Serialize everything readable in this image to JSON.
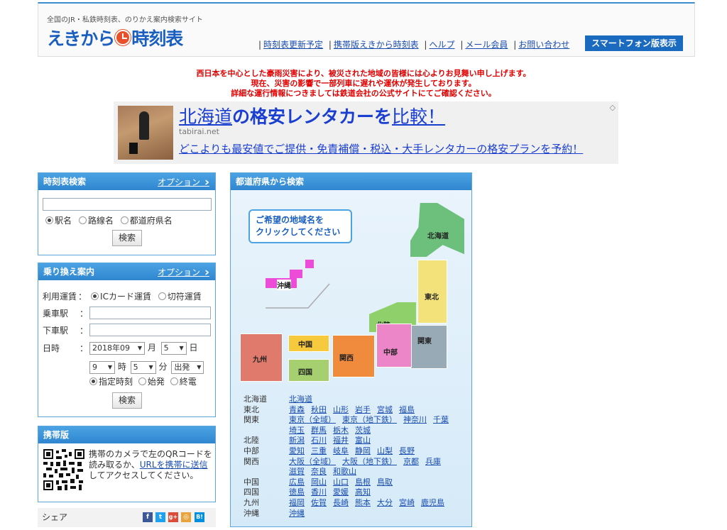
{
  "header": {
    "tagline": "全国のJR・私鉄時刻表、のりかえ案内検索サイト",
    "logo_left": "えきから",
    "logo_right": "時刻表",
    "nav": [
      "時刻表更新予定",
      "携帯版えきから時刻表",
      "ヘルプ",
      "メール会員",
      "お問い合わせ"
    ],
    "smartphone_button": "スマートフォン版表示"
  },
  "notice": [
    "西日本を中心とした豪雨災害により、被災された地域の皆様には心よりお見舞い申し上げます。",
    "現在、災害の影響で一部列車に遅れや運休が発生しております。",
    "詳細な運行情報につきましては鉄道会社の公式サイトにてご確認ください。"
  ],
  "ad": {
    "title_a": "北海道",
    "title_b": "の格安",
    "title_c": "レンタカーを",
    "title_d": "比較！",
    "domain": "tabirai.net",
    "description": "どこよりも最安値でご提供・免責補償・税込・大手レンタカーの格安プランを予約！"
  },
  "timetable": {
    "title": "時刻表検索",
    "option": "オプション",
    "input_value": "",
    "radio": [
      "駅名",
      "路線名",
      "都道府県名"
    ],
    "search": "検索"
  },
  "transfer": {
    "title": "乗り換え案内",
    "option": "オプション",
    "fare_label": "利用運賃",
    "fare_options": [
      "ICカード運賃",
      "切符運賃"
    ],
    "from_label": "乗車駅",
    "to_label": "下車駅",
    "date_label": "日時",
    "year_month": "2018年09",
    "month_unit": "月",
    "day": "5",
    "day_unit": "日",
    "hour": "9",
    "hour_unit": "時",
    "minute": "5",
    "minute_unit": "分",
    "mode": "出発",
    "time_options": [
      "指定時刻",
      "始発",
      "終電"
    ],
    "search": "検索",
    "colon": "："
  },
  "mobile": {
    "title": "携帯版",
    "text_a": "携帯のカメラで左のQRコードを読み取るか、",
    "link": "URLを携帯に送信",
    "text_b": "してアクセスしてください。"
  },
  "share": {
    "label": "シェア",
    "icons": [
      "f",
      "t",
      "g+",
      "◎",
      "B!"
    ]
  },
  "prefecture": {
    "title": "都道府県から検索",
    "callout_1": "ご希望の地域名を",
    "callout_2": "クリックしてください",
    "regions": {
      "hokkaido": "北海道",
      "tohoku": "東北",
      "hokuriku": "北陸",
      "kanto": "関東",
      "chubu": "中部",
      "kansai": "関西",
      "chugoku": "中国",
      "shikoku": "四国",
      "kyushu": "九州",
      "okinawa": "沖縄"
    },
    "list": [
      {
        "region": "北海道",
        "prefs": [
          "北海道"
        ]
      },
      {
        "region": "東北",
        "prefs": [
          "青森",
          "秋田",
          "山形",
          "岩手",
          "宮城",
          "福島"
        ]
      },
      {
        "region": "関東",
        "prefs": [
          "東京（全域）",
          "東京（地下鉄）",
          "神奈川",
          "千葉"
        ]
      },
      {
        "region": "",
        "prefs": [
          "埼玉",
          "群馬",
          "栃木",
          "茨城"
        ]
      },
      {
        "region": "北陸",
        "prefs": [
          "新潟",
          "石川",
          "福井",
          "富山"
        ]
      },
      {
        "region": "中部",
        "prefs": [
          "愛知",
          "三重",
          "岐阜",
          "静岡",
          "山梨",
          "長野"
        ]
      },
      {
        "region": "関西",
        "prefs": [
          "大阪（全域）",
          "大阪（地下鉄）",
          "京都",
          "兵庫"
        ]
      },
      {
        "region": "",
        "prefs": [
          "滋賀",
          "奈良",
          "和歌山"
        ]
      },
      {
        "region": "中国",
        "prefs": [
          "広島",
          "岡山",
          "山口",
          "島根",
          "鳥取"
        ]
      },
      {
        "region": "四国",
        "prefs": [
          "徳島",
          "香川",
          "愛媛",
          "高知"
        ]
      },
      {
        "region": "九州",
        "prefs": [
          "福岡",
          "佐賀",
          "長崎",
          "熊本",
          "大分",
          "宮崎",
          "鹿児島"
        ]
      },
      {
        "region": "沖縄",
        "prefs": [
          "沖縄"
        ]
      }
    ]
  },
  "colors": {
    "accent": "#2f86cf",
    "notice": "#e00000",
    "hokkaido": "#6cc07c",
    "tohoku": "#f3e27a",
    "hokuriku": "#8fd06a",
    "kanto": "#98aab6",
    "chubu": "#ec86c8",
    "kansai": "#f08a3c",
    "chugoku": "#f7c93c",
    "shikoku": "#a6d070",
    "kyushu": "#e07a6c",
    "okinawa": "#ec4cd8"
  }
}
